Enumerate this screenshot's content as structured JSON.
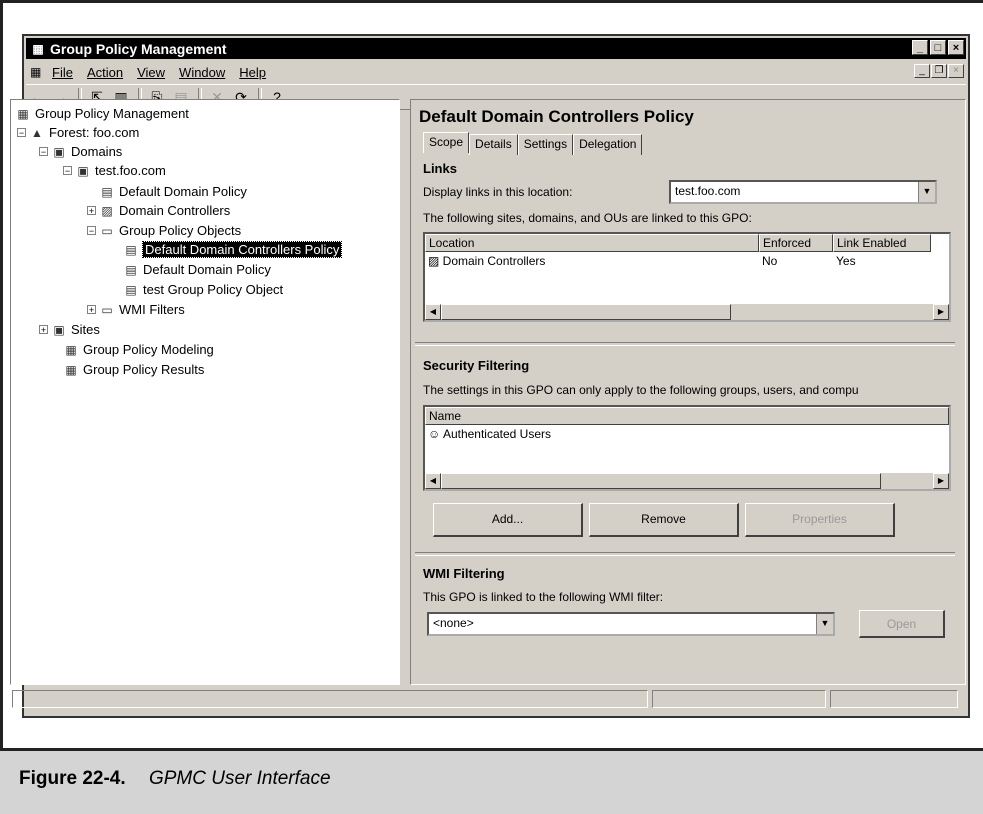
{
  "window": {
    "title": "Group Policy Management"
  },
  "menu": {
    "file": "File",
    "action": "Action",
    "view": "View",
    "window": "Window",
    "help": "Help"
  },
  "tree": {
    "root": "Group Policy Management",
    "forest": "Forest: foo.com",
    "domains": "Domains",
    "domain": "test.foo.com",
    "default_domain_policy": "Default Domain Policy",
    "domain_controllers": "Domain Controllers",
    "gpo_container": "Group Policy Objects",
    "gpo_selected": "Default Domain Controllers Policy",
    "gpo_default": "Default Domain Policy",
    "gpo_test": "test Group Policy Object",
    "wmi_filters": "WMI Filters",
    "sites": "Sites",
    "modeling": "Group Policy Modeling",
    "results": "Group Policy Results"
  },
  "detail": {
    "title": "Default Domain Controllers Policy",
    "tabs": [
      "Scope",
      "Details",
      "Settings",
      "Delegation"
    ],
    "links": {
      "heading": "Links",
      "display_label": "Display links in this location:",
      "location_value": "test.foo.com",
      "linked_label": "The following sites, domains, and OUs are linked to this GPO:",
      "columns": [
        "Location",
        "Enforced",
        "Link Enabled"
      ],
      "rows": [
        {
          "location": "Domain Controllers",
          "enforced": "No",
          "enabled": "Yes"
        }
      ]
    },
    "security": {
      "heading": "Security Filtering",
      "desc": "The settings in this GPO can only apply to the following groups, users, and compu",
      "columns": [
        "Name"
      ],
      "rows": [
        "Authenticated Users"
      ],
      "add": "Add...",
      "remove": "Remove",
      "properties": "Properties"
    },
    "wmi": {
      "heading": "WMI Filtering",
      "desc": "This GPO is linked to the following WMI filter:",
      "value": "<none>",
      "open": "Open"
    }
  },
  "caption": {
    "number": "Figure 22-4.",
    "title": "GPMC User Interface"
  }
}
